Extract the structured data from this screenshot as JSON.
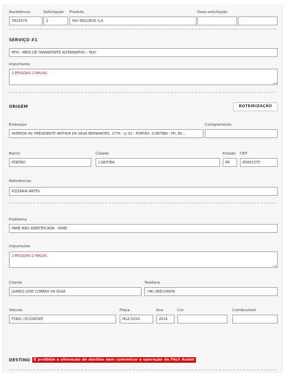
{
  "header": {
    "assistencia": {
      "label": "Assistência",
      "value": "7813574"
    },
    "solicitacao": {
      "label": "Solicitação",
      "value": "2"
    },
    "produto": {
      "label": "Produto",
      "value": "HDI SEGUROS S.A"
    },
    "data_solicitacao": {
      "label": "Data solicitação",
      "date": "",
      "time": ""
    }
  },
  "servico": {
    "title": "SERVIÇO #1",
    "tipo_value": "MTA - MEIO DE TRANSPORTE ALTERNATIVO - TAXI",
    "importante_label": "Importante",
    "importante_value": "2 PESSOAS 2 MALAS"
  },
  "origem": {
    "title": "ORIGEM",
    "roteirizacao_button": "ROTEIRIZAÇÃO",
    "endereco": {
      "label": "Endereço",
      "value": "AVENIDA AV. PRESIDENTE ARTHUR DA SILVA BERNARDES, 1774 - LJ 02 - PORTÃO, CURITIBA - PR, 80..."
    },
    "complemento": {
      "label": "Complemento",
      "value": ""
    },
    "bairro": {
      "label": "Bairro",
      "value": "PORTÃO"
    },
    "cidade": {
      "label": "Cidade",
      "value": "CURITIBA"
    },
    "estado": {
      "label": "Estado",
      "value": "PR"
    },
    "cep": {
      "label": "CEP",
      "value": "85601375"
    },
    "referencias": {
      "label": "Referências",
      "value": "PIZZARIA ARTES"
    }
  },
  "problema": {
    "label": "Problema",
    "value": "PANE NÃO IDENTIFICADA - PANE",
    "importante_label": "Importante",
    "importante_value": "2 PESSOAS 2 MALAS"
  },
  "cliente": {
    "cliente": {
      "label": "Cliente",
      "value": "JUAREZ JOSE CORREA DA SILVA"
    },
    "telefone": {
      "label": "Telefone",
      "value": "(46) 988154609"
    }
  },
  "veiculo": {
    "veiculo": {
      "label": "Veículo",
      "value": "FORD / ECOSPORT"
    },
    "placa": {
      "label": "Placa",
      "value": "MLZ-XXXX"
    },
    "ano": {
      "label": "Ano",
      "value": "2014"
    },
    "cor": {
      "label": "Cor",
      "value": ""
    },
    "combustivel": {
      "label": "Combustível",
      "value": ""
    }
  },
  "destino": {
    "title": "DESTINO",
    "warning": "É proibida a alteração de destino sem comunicar a operação da Fácil Assist"
  }
}
